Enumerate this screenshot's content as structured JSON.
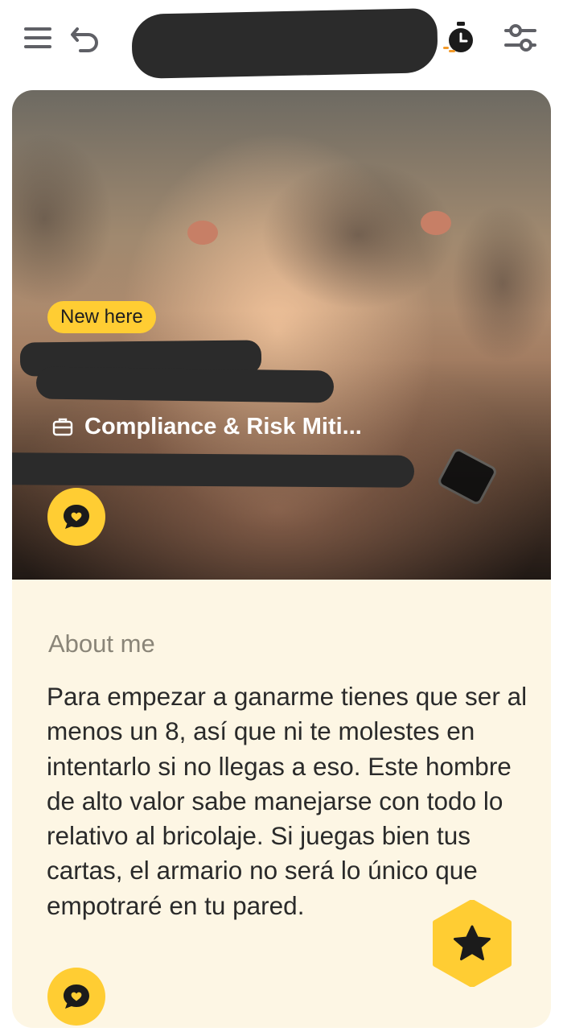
{
  "topbar": {
    "icons": [
      "menu-icon",
      "undo-icon",
      "timer-icon",
      "filter-icon"
    ],
    "name_redacted": true
  },
  "profile": {
    "badge": "New here",
    "job": "Compliance & Risk Miti...",
    "job_icon": "briefcase-icon",
    "name_redacted": true,
    "school_redacted": true
  },
  "about": {
    "title": "About me",
    "text": "Para empezar a ganarme tienes que ser al menos un 8, así que ni te molestes en intentarlo si no llegas a eso. Este hombre de alto valor sabe manejarse con todo lo relativo al bricolaje. Si juegas bien tus cartas, el armario no será lo único que empotraré en tu pared."
  },
  "actions": {
    "chat_icon": "chat-bubble-heart-icon",
    "superswipe_icon": "star-icon"
  },
  "colors": {
    "accent_yellow": "#ffcd33",
    "card_background": "#fdf6e4",
    "icon_gray": "#5f6066",
    "timer_orange": "#f39a2b"
  }
}
